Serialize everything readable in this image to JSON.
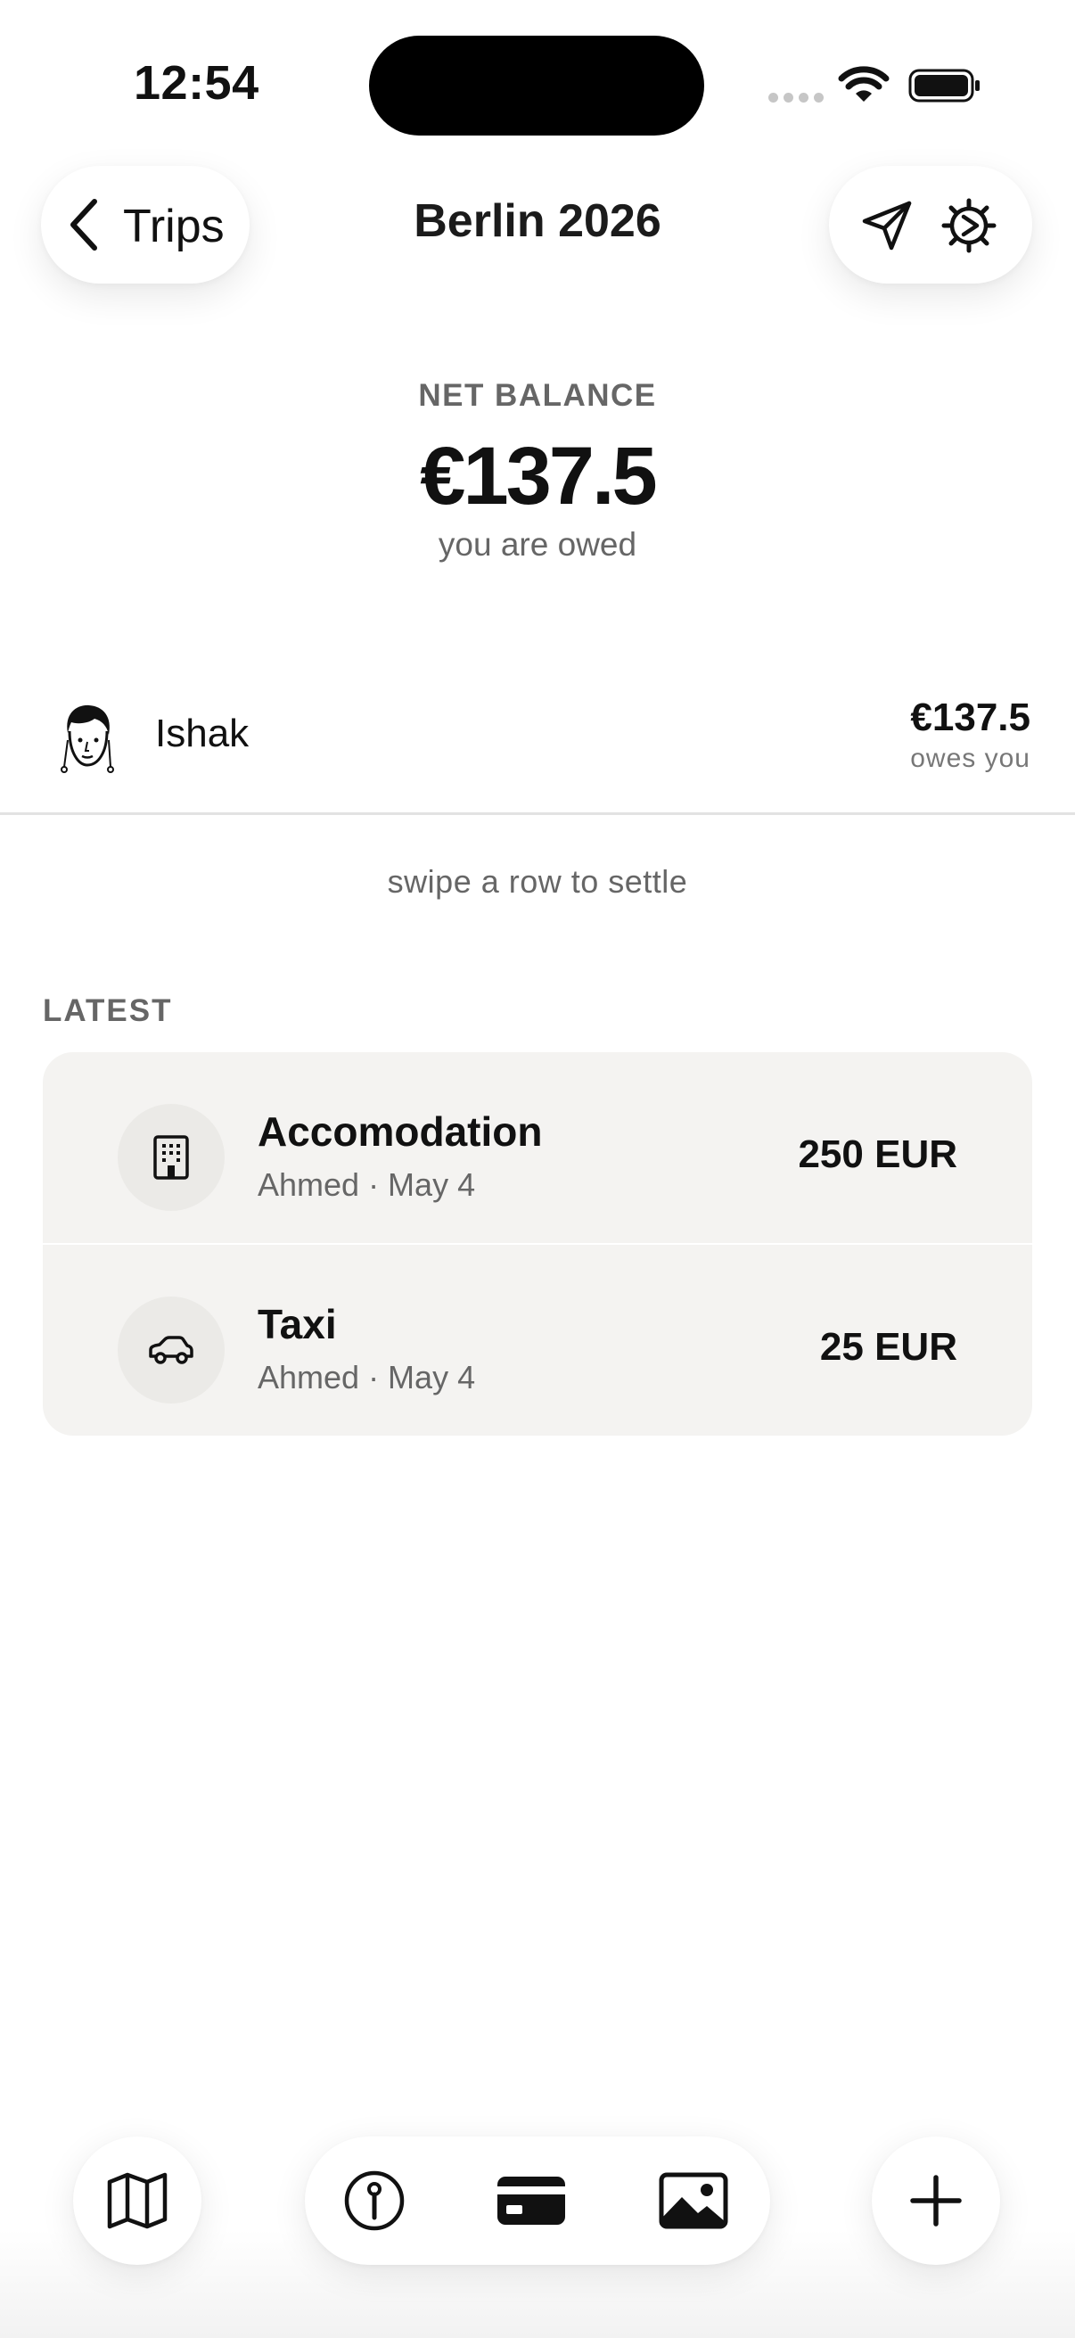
{
  "status_bar": {
    "time": "12:54"
  },
  "header": {
    "back_label": "Trips",
    "title": "Berlin 2026"
  },
  "balance": {
    "label": "NET BALANCE",
    "amount": "€137.5",
    "subtitle": "you are owed"
  },
  "people": [
    {
      "name": "Ishak",
      "amount": "€137.5",
      "status": "owes you"
    }
  ],
  "hint": "swipe a row to settle",
  "latest": {
    "label": "LATEST",
    "items": [
      {
        "title": "Accomodation",
        "meta": "Ahmed · May 4",
        "amount": "250 EUR",
        "icon": "building-icon"
      },
      {
        "title": "Taxi",
        "meta": "Ahmed · May 4",
        "amount": "25 EUR",
        "icon": "car-icon"
      }
    ]
  },
  "bottom_nav": {
    "icons": [
      "map-icon",
      "info-icon",
      "card-icon",
      "photo-icon",
      "plus-icon"
    ]
  }
}
